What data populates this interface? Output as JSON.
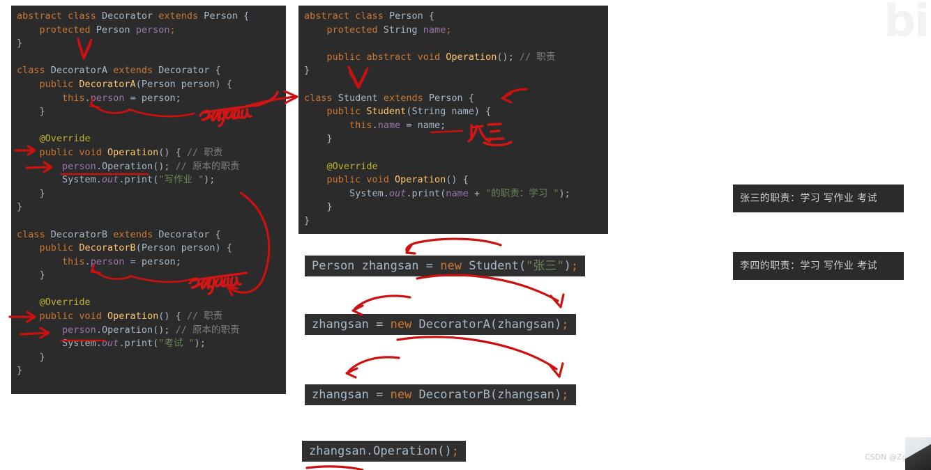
{
  "panels": {
    "left": {
      "title": "decorator-classes-code",
      "lines": [
        [
          {
            "t": "abstract ",
            "c": "kw"
          },
          {
            "t": "class ",
            "c": "kw"
          },
          {
            "t": "Decorator ",
            "c": "cls"
          },
          {
            "t": "extends ",
            "c": "kw"
          },
          {
            "t": "Person {",
            "c": "cls"
          }
        ],
        [
          {
            "t": "    protected ",
            "c": "kw"
          },
          {
            "t": "Person ",
            "c": "cls"
          },
          {
            "t": "person",
            "c": "fld"
          },
          {
            "t": ";",
            "c": "pun"
          }
        ],
        [
          {
            "t": "}",
            "c": "plain"
          }
        ],
        [
          {
            "t": "",
            "c": "plain"
          }
        ],
        [
          {
            "t": "class ",
            "c": "kw"
          },
          {
            "t": "DecoratorA ",
            "c": "cls"
          },
          {
            "t": "extends ",
            "c": "kw"
          },
          {
            "t": "Decorator {",
            "c": "cls"
          }
        ],
        [
          {
            "t": "    public ",
            "c": "kw"
          },
          {
            "t": "DecoratorA",
            "c": "mth"
          },
          {
            "t": "(Person person) {",
            "c": "cls"
          }
        ],
        [
          {
            "t": "        this",
            "c": "kw"
          },
          {
            "t": ".",
            "c": "plain"
          },
          {
            "t": "person",
            "c": "fld"
          },
          {
            "t": " = person;",
            "c": "plain"
          }
        ],
        [
          {
            "t": "    }",
            "c": "plain"
          }
        ],
        [
          {
            "t": "",
            "c": "plain"
          }
        ],
        [
          {
            "t": "    @Override",
            "c": "ann"
          }
        ],
        [
          {
            "t": "    public ",
            "c": "kw"
          },
          {
            "t": "void ",
            "c": "kw"
          },
          {
            "t": "Operation",
            "c": "mth"
          },
          {
            "t": "() { ",
            "c": "plain"
          },
          {
            "t": "// 职责",
            "c": "cmt"
          }
        ],
        [
          {
            "t": "        ",
            "c": "plain"
          },
          {
            "t": "person",
            "c": "fld"
          },
          {
            "t": ".Operation(); ",
            "c": "plain"
          },
          {
            "t": "// 原本的职责",
            "c": "cmt"
          }
        ],
        [
          {
            "t": "        System.",
            "c": "plain"
          },
          {
            "t": "out",
            "c": "stat"
          },
          {
            "t": ".print(",
            "c": "plain"
          },
          {
            "t": "\"写作业 \"",
            "c": "str"
          },
          {
            "t": ");",
            "c": "plain"
          }
        ],
        [
          {
            "t": "    }",
            "c": "plain"
          }
        ],
        [
          {
            "t": "}",
            "c": "plain"
          }
        ],
        [
          {
            "t": "",
            "c": "plain"
          }
        ],
        [
          {
            "t": "class ",
            "c": "kw"
          },
          {
            "t": "DecoratorB ",
            "c": "cls"
          },
          {
            "t": "extends ",
            "c": "kw"
          },
          {
            "t": "Decorator {",
            "c": "cls"
          }
        ],
        [
          {
            "t": "    public ",
            "c": "kw"
          },
          {
            "t": "DecoratorB",
            "c": "mth"
          },
          {
            "t": "(Person person) {",
            "c": "cls"
          }
        ],
        [
          {
            "t": "        this",
            "c": "kw"
          },
          {
            "t": ".",
            "c": "plain"
          },
          {
            "t": "person",
            "c": "fld"
          },
          {
            "t": " = person;",
            "c": "plain"
          }
        ],
        [
          {
            "t": "    }",
            "c": "plain"
          }
        ],
        [
          {
            "t": "",
            "c": "plain"
          }
        ],
        [
          {
            "t": "    @Override",
            "c": "ann"
          }
        ],
        [
          {
            "t": "    public ",
            "c": "kw"
          },
          {
            "t": "void ",
            "c": "kw"
          },
          {
            "t": "Operation",
            "c": "mth"
          },
          {
            "t": "() { ",
            "c": "plain"
          },
          {
            "t": "// 职责",
            "c": "cmt"
          }
        ],
        [
          {
            "t": "        ",
            "c": "plain"
          },
          {
            "t": "person",
            "c": "fld"
          },
          {
            "t": ".Operation(); ",
            "c": "plain"
          },
          {
            "t": "// 原本的职责",
            "c": "cmt"
          }
        ],
        [
          {
            "t": "        System.",
            "c": "plain"
          },
          {
            "t": "out",
            "c": "stat"
          },
          {
            "t": ".print(",
            "c": "plain"
          },
          {
            "t": "\"考试 \"",
            "c": "str"
          },
          {
            "t": ");",
            "c": "plain"
          }
        ],
        [
          {
            "t": "    }",
            "c": "plain"
          }
        ],
        [
          {
            "t": "}",
            "c": "plain"
          }
        ]
      ]
    },
    "right": {
      "title": "person-student-code",
      "lines": [
        [
          {
            "t": "abstract ",
            "c": "kw"
          },
          {
            "t": "class ",
            "c": "kw"
          },
          {
            "t": "Person {",
            "c": "cls"
          }
        ],
        [
          {
            "t": "    protected ",
            "c": "kw"
          },
          {
            "t": "String ",
            "c": "cls"
          },
          {
            "t": "name",
            "c": "fld"
          },
          {
            "t": ";",
            "c": "pun"
          }
        ],
        [
          {
            "t": "",
            "c": "plain"
          }
        ],
        [
          {
            "t": "    public ",
            "c": "kw"
          },
          {
            "t": "abstract ",
            "c": "kw"
          },
          {
            "t": "void ",
            "c": "kw"
          },
          {
            "t": "Operation",
            "c": "mth"
          },
          {
            "t": "(); ",
            "c": "plain"
          },
          {
            "t": "// 职责",
            "c": "cmt"
          }
        ],
        [
          {
            "t": "}",
            "c": "plain"
          }
        ],
        [
          {
            "t": "",
            "c": "plain"
          }
        ],
        [
          {
            "t": "class ",
            "c": "kw"
          },
          {
            "t": "Student ",
            "c": "cls"
          },
          {
            "t": "extends ",
            "c": "kw"
          },
          {
            "t": "Person {",
            "c": "cls"
          }
        ],
        [
          {
            "t": "    public ",
            "c": "kw"
          },
          {
            "t": "Student",
            "c": "mth"
          },
          {
            "t": "(String name) {",
            "c": "cls"
          }
        ],
        [
          {
            "t": "        this",
            "c": "kw"
          },
          {
            "t": ".",
            "c": "plain"
          },
          {
            "t": "name",
            "c": "fld"
          },
          {
            "t": " = name;",
            "c": "plain"
          }
        ],
        [
          {
            "t": "    }",
            "c": "plain"
          }
        ],
        [
          {
            "t": "",
            "c": "plain"
          }
        ],
        [
          {
            "t": "    @Override",
            "c": "ann"
          }
        ],
        [
          {
            "t": "    public ",
            "c": "kw"
          },
          {
            "t": "void ",
            "c": "kw"
          },
          {
            "t": "Operation",
            "c": "mth"
          },
          {
            "t": "() {",
            "c": "plain"
          }
        ],
        [
          {
            "t": "        System.",
            "c": "plain"
          },
          {
            "t": "out",
            "c": "stat"
          },
          {
            "t": ".print(",
            "c": "plain"
          },
          {
            "t": "name",
            "c": "fld"
          },
          {
            "t": " + ",
            "c": "plain"
          },
          {
            "t": "\"的职责：学习 \"",
            "c": "str"
          },
          {
            "t": ");",
            "c": "plain"
          }
        ],
        [
          {
            "t": "    }",
            "c": "plain"
          }
        ],
        [
          {
            "t": "}",
            "c": "plain"
          }
        ]
      ]
    }
  },
  "statements": [
    {
      "name": "stmt-new-student",
      "segments": [
        {
          "t": "Person zhangsan = ",
          "c": "plain"
        },
        {
          "t": "new ",
          "c": "kw"
        },
        {
          "t": "Student(",
          "c": "plain"
        },
        {
          "t": "\"张三\"",
          "c": "str"
        },
        {
          "t": ")",
          "c": "plain"
        },
        {
          "t": ";",
          "c": "pun"
        }
      ]
    },
    {
      "name": "stmt-wrap-decorator-a",
      "segments": [
        {
          "t": "zhangsan = ",
          "c": "plain"
        },
        {
          "t": "new ",
          "c": "kw"
        },
        {
          "t": "DecoratorA(zhangsan)",
          "c": "plain"
        },
        {
          "t": ";",
          "c": "pun"
        }
      ]
    },
    {
      "name": "stmt-wrap-decorator-b",
      "segments": [
        {
          "t": "zhangsan = ",
          "c": "plain"
        },
        {
          "t": "new ",
          "c": "kw"
        },
        {
          "t": "DecoratorB(zhangsan)",
          "c": "plain"
        },
        {
          "t": ";",
          "c": "pun"
        }
      ]
    },
    {
      "name": "stmt-call-operation",
      "segments": [
        {
          "t": "zhangsan.Operation()",
          "c": "plain"
        },
        {
          "t": ";",
          "c": "pun"
        }
      ]
    }
  ],
  "console_outputs": [
    {
      "name": "console-output-zhangsan",
      "text": "张三的职责：学习 写作业 考试"
    },
    {
      "name": "console-output-lisi",
      "text": "李四的职责：学习 写作业 考试"
    }
  ],
  "handwriting": [
    {
      "name": "handwritten-zhangsan-upper",
      "text": "zhangsan"
    },
    {
      "name": "handwritten-zhangsan-lower",
      "text": "zhangsan"
    },
    {
      "name": "handwritten-zhangsan-cjk",
      "text": "张三"
    }
  ],
  "watermarks": {
    "bilibili": "bi",
    "csdn": "CSDN @Zgaoyi"
  },
  "colors": {
    "editor_background": "#2b2b2b",
    "statement_background": "#2f2f2f",
    "keyword": "#cc7832",
    "method": "#ffc66d",
    "field": "#9876aa",
    "string": "#6a8759",
    "comment": "#808080",
    "annotation": "#bbb529",
    "default_text": "#a9b7c6",
    "ink_red": "#cc1111",
    "page_background": "#ffffff"
  }
}
